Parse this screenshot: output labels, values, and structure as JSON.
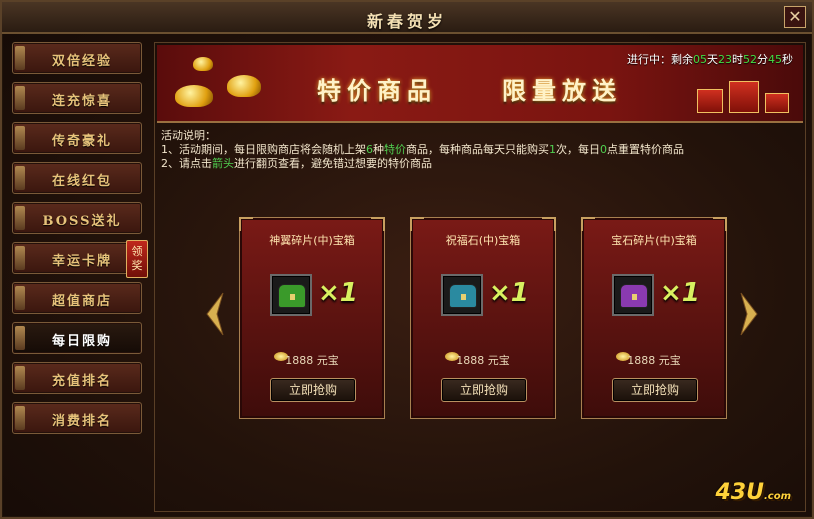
{
  "window": {
    "title": "新春贺岁",
    "close_label": "✕"
  },
  "sidebar": {
    "items": [
      {
        "label": "双倍经验"
      },
      {
        "label": "连充惊喜"
      },
      {
        "label": "传奇豪礼"
      },
      {
        "label": "在线红包"
      },
      {
        "label": "BOSS送礼"
      },
      {
        "label": "幸运卡牌"
      },
      {
        "label": "超值商店"
      },
      {
        "label": "每日限购",
        "active": true
      },
      {
        "label": "充值排名"
      },
      {
        "label": "消费排名"
      }
    ],
    "badge": "领奖"
  },
  "banner": {
    "text1": "特价商品",
    "text2": "限量放送"
  },
  "countdown": {
    "prefix": "进行中：剩余",
    "days": "05",
    "days_unit": "天",
    "hours": "23",
    "hours_unit": "时",
    "minutes": "52",
    "minutes_unit": "分",
    "seconds": "45",
    "seconds_unit": "秒"
  },
  "description": {
    "heading": "活动说明：",
    "line1_a": "1、活动期间，每日限购商店将会随机上架",
    "line1_num": "6",
    "line1_b": "种",
    "line1_hl": "特价",
    "line1_c": "商品，每种商品每天只能购买",
    "line1_num2": "1",
    "line1_d": "次，每日",
    "line1_num3": "0",
    "line1_e": "点重置特价商品",
    "line2_a": "2、请点击",
    "line2_hl": "箭头",
    "line2_b": "进行翻页查看，避免错过想要的特价商品"
  },
  "cards": [
    {
      "name": "神翼碎片(中)宝箱",
      "qty": "×1",
      "price": "1888",
      "unit": "元宝",
      "buy_label": "立即抢购",
      "chest_color": "#3a9a2a"
    },
    {
      "name": "祝福石(中)宝箱",
      "qty": "×1",
      "price": "1888",
      "unit": "元宝",
      "buy_label": "立即抢购",
      "chest_color": "#2a8aa0"
    },
    {
      "name": "宝石碎片(中)宝箱",
      "qty": "×1",
      "price": "1888",
      "unit": "元宝",
      "buy_label": "立即抢购",
      "chest_color": "#8a3ab0"
    }
  ],
  "watermark": {
    "text": "43U",
    "suffix": ".com"
  }
}
